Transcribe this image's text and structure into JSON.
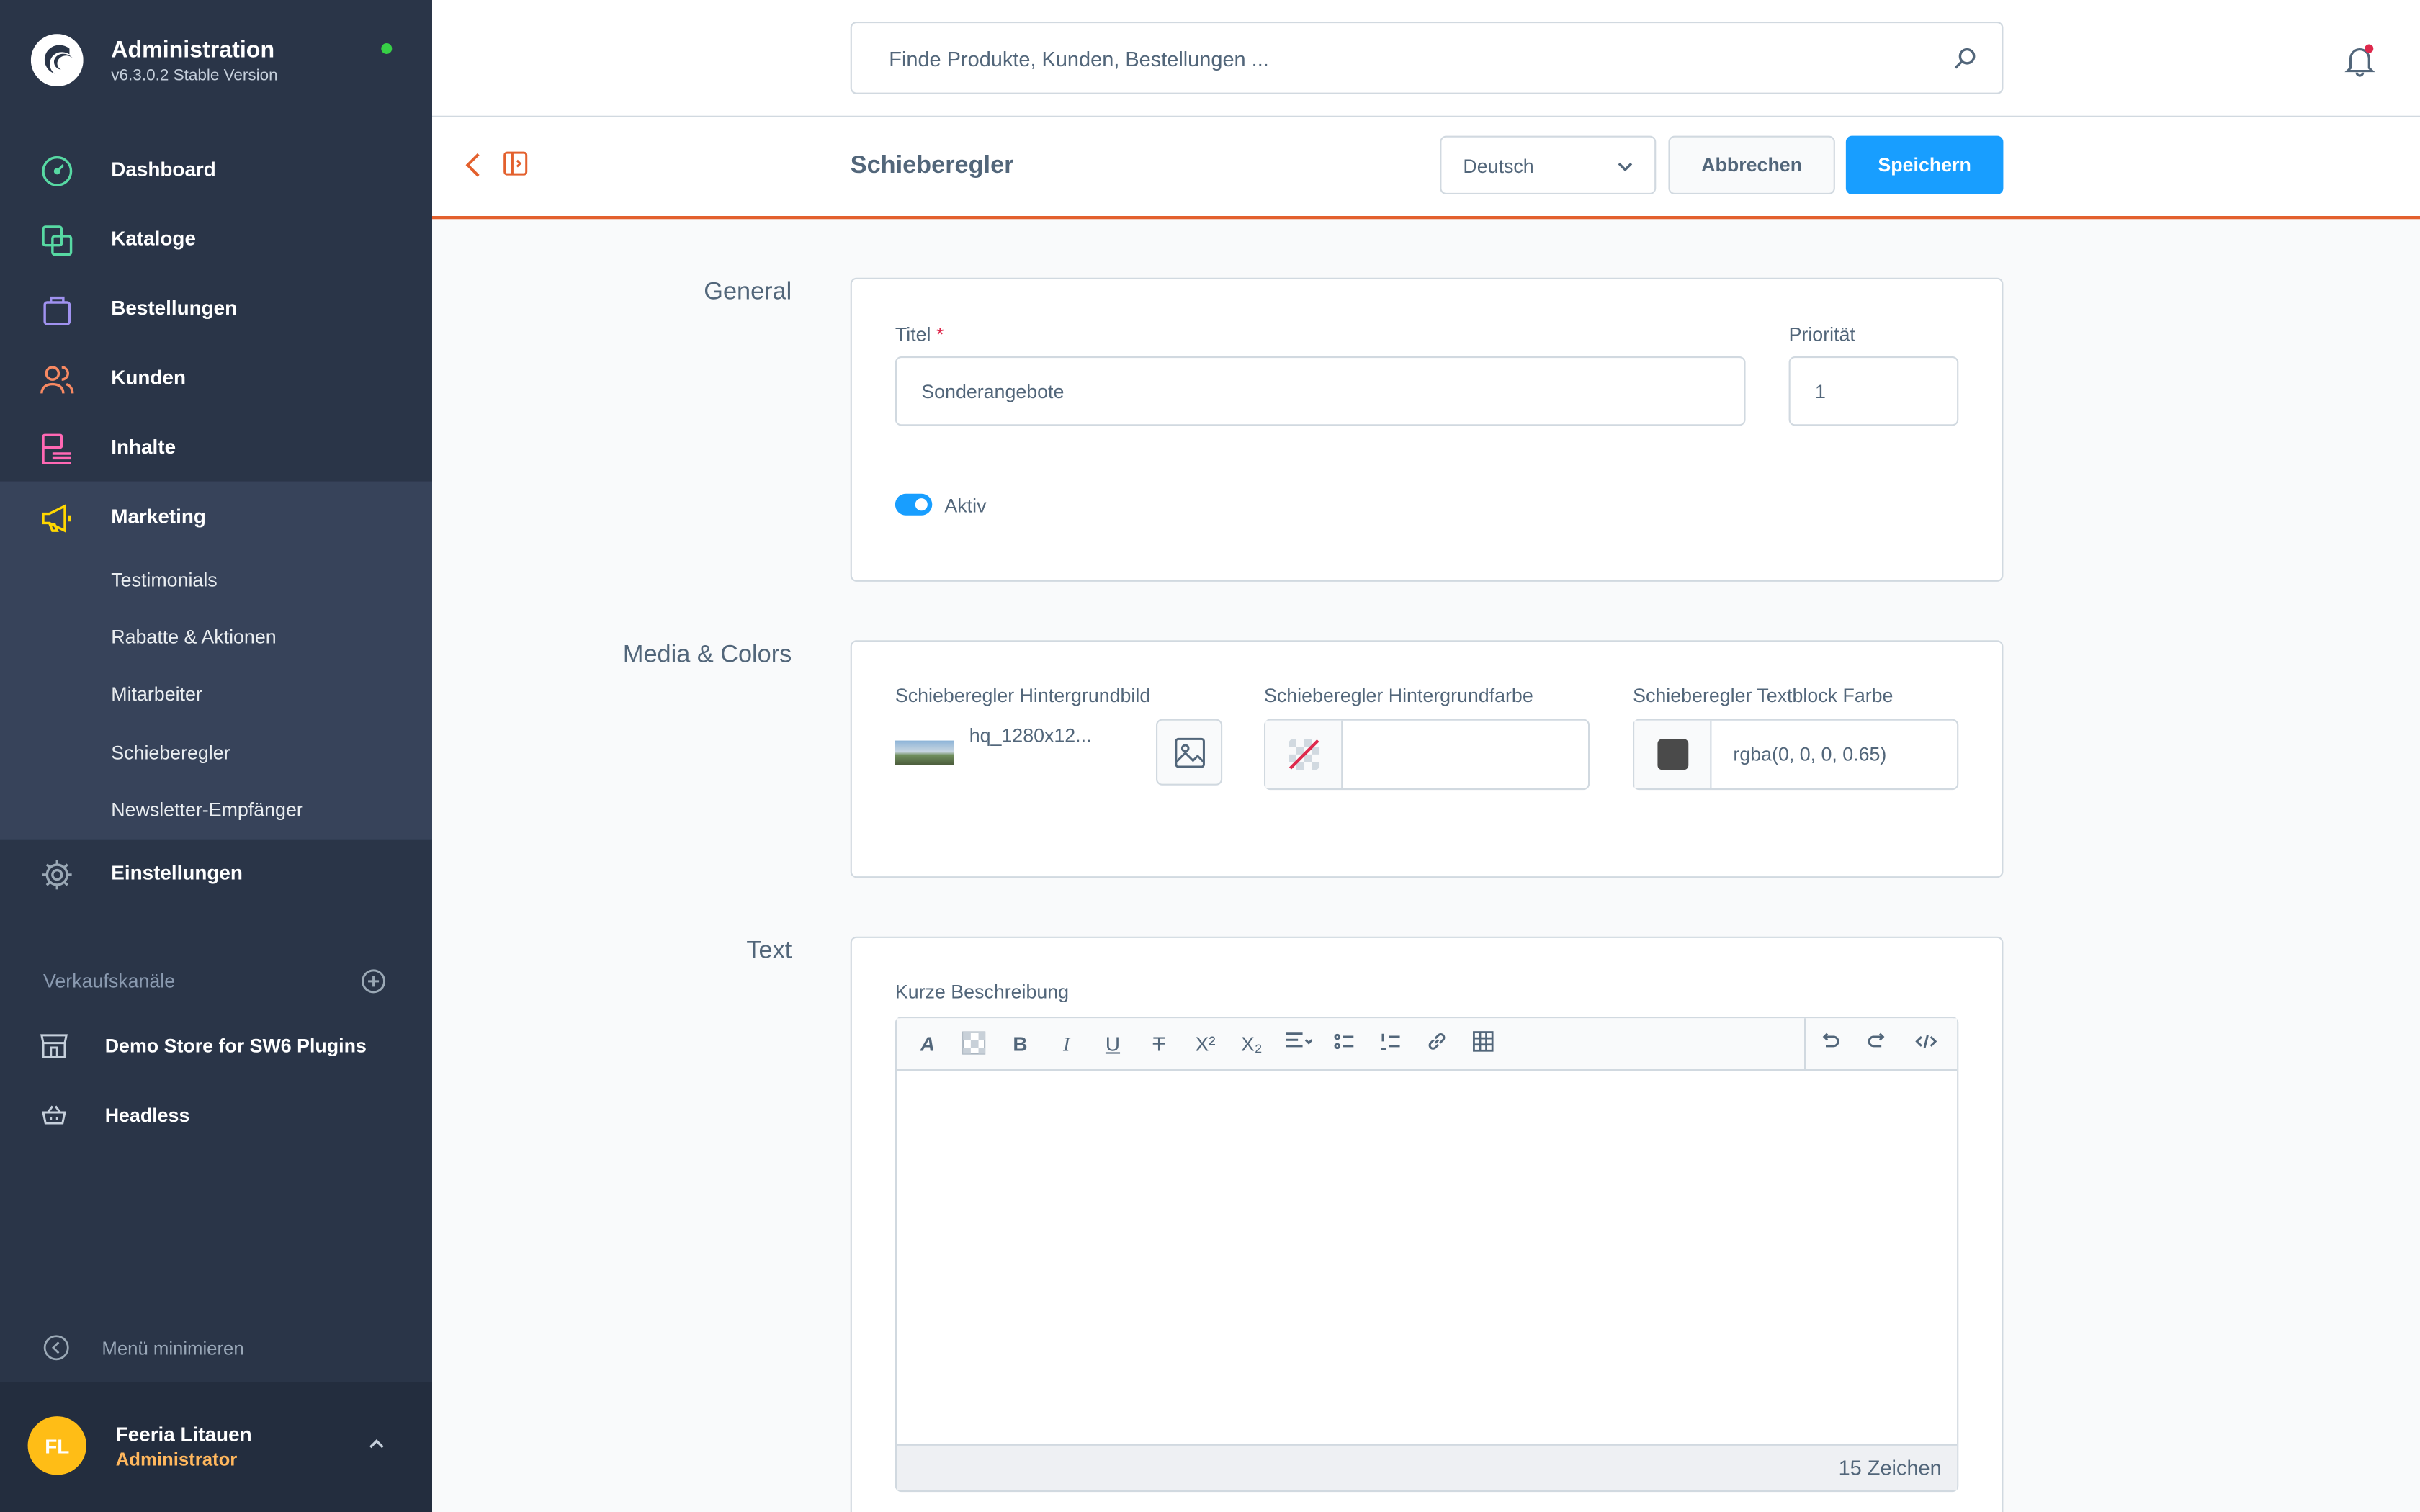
{
  "app": {
    "title": "Administration",
    "version": "v6.3.0.2 Stable Version",
    "status_color": "#37d046"
  },
  "nav": {
    "items": [
      {
        "label": "Dashboard",
        "icon": "gauge-icon",
        "color": "#57d9a3"
      },
      {
        "label": "Kataloge",
        "icon": "catalog-icon",
        "color": "#57d9a3"
      },
      {
        "label": "Bestellungen",
        "icon": "shopping-bag-icon",
        "color": "#a092f0"
      },
      {
        "label": "Kunden",
        "icon": "users-icon",
        "color": "#f88962"
      },
      {
        "label": "Inhalte",
        "icon": "content-icon",
        "color": "#ff68b4"
      },
      {
        "label": "Marketing",
        "icon": "megaphone-icon",
        "color": "#ffd700"
      },
      {
        "label": "Einstellungen",
        "icon": "gear-icon",
        "color": "#9aa8b5"
      }
    ],
    "marketing_sub": [
      "Testimonials",
      "Rabatte & Aktionen",
      "Mitarbeiter",
      "Schieberegler",
      "Newsletter-Empfänger"
    ],
    "sales_channels_title": "Verkaufskanäle",
    "sales_channels": [
      {
        "label": "Demo Store for SW6 Plugins",
        "icon": "storefront-icon"
      },
      {
        "label": "Headless",
        "icon": "basket-icon"
      }
    ],
    "minimize": "Menü minimieren"
  },
  "user": {
    "initials": "FL",
    "name": "Feeria Litauen",
    "role": "Administrator"
  },
  "search": {
    "placeholder": "Finde Produkte, Kunden, Bestellungen ..."
  },
  "smartbar": {
    "title": "Schieberegler",
    "language": "Deutsch",
    "cancel": "Abbrechen",
    "save": "Speichern",
    "accent": "#e3602d",
    "primary": "#189eff"
  },
  "general": {
    "section": "General",
    "title_label": "Titel",
    "required_mark": "*",
    "title_value": "Sonderangebote",
    "priority_label": "Priorität",
    "priority_value": "1",
    "active_label": "Aktiv",
    "active": true
  },
  "media": {
    "section": "Media & Colors",
    "bg_image_label": "Schieberegler Hintergrundbild",
    "bg_image_file": "hq_1280x12...",
    "bg_color_label": "Schieberegler Hintergrundfarbe",
    "bg_color_value": "",
    "text_color_label": "Schieberegler Textblock Farbe",
    "text_color_value": "rgba(0, 0, 0, 0.65)"
  },
  "text": {
    "section": "Text",
    "short_desc_label": "Kurze Beschreibung",
    "char_count": "15 Zeichen"
  }
}
